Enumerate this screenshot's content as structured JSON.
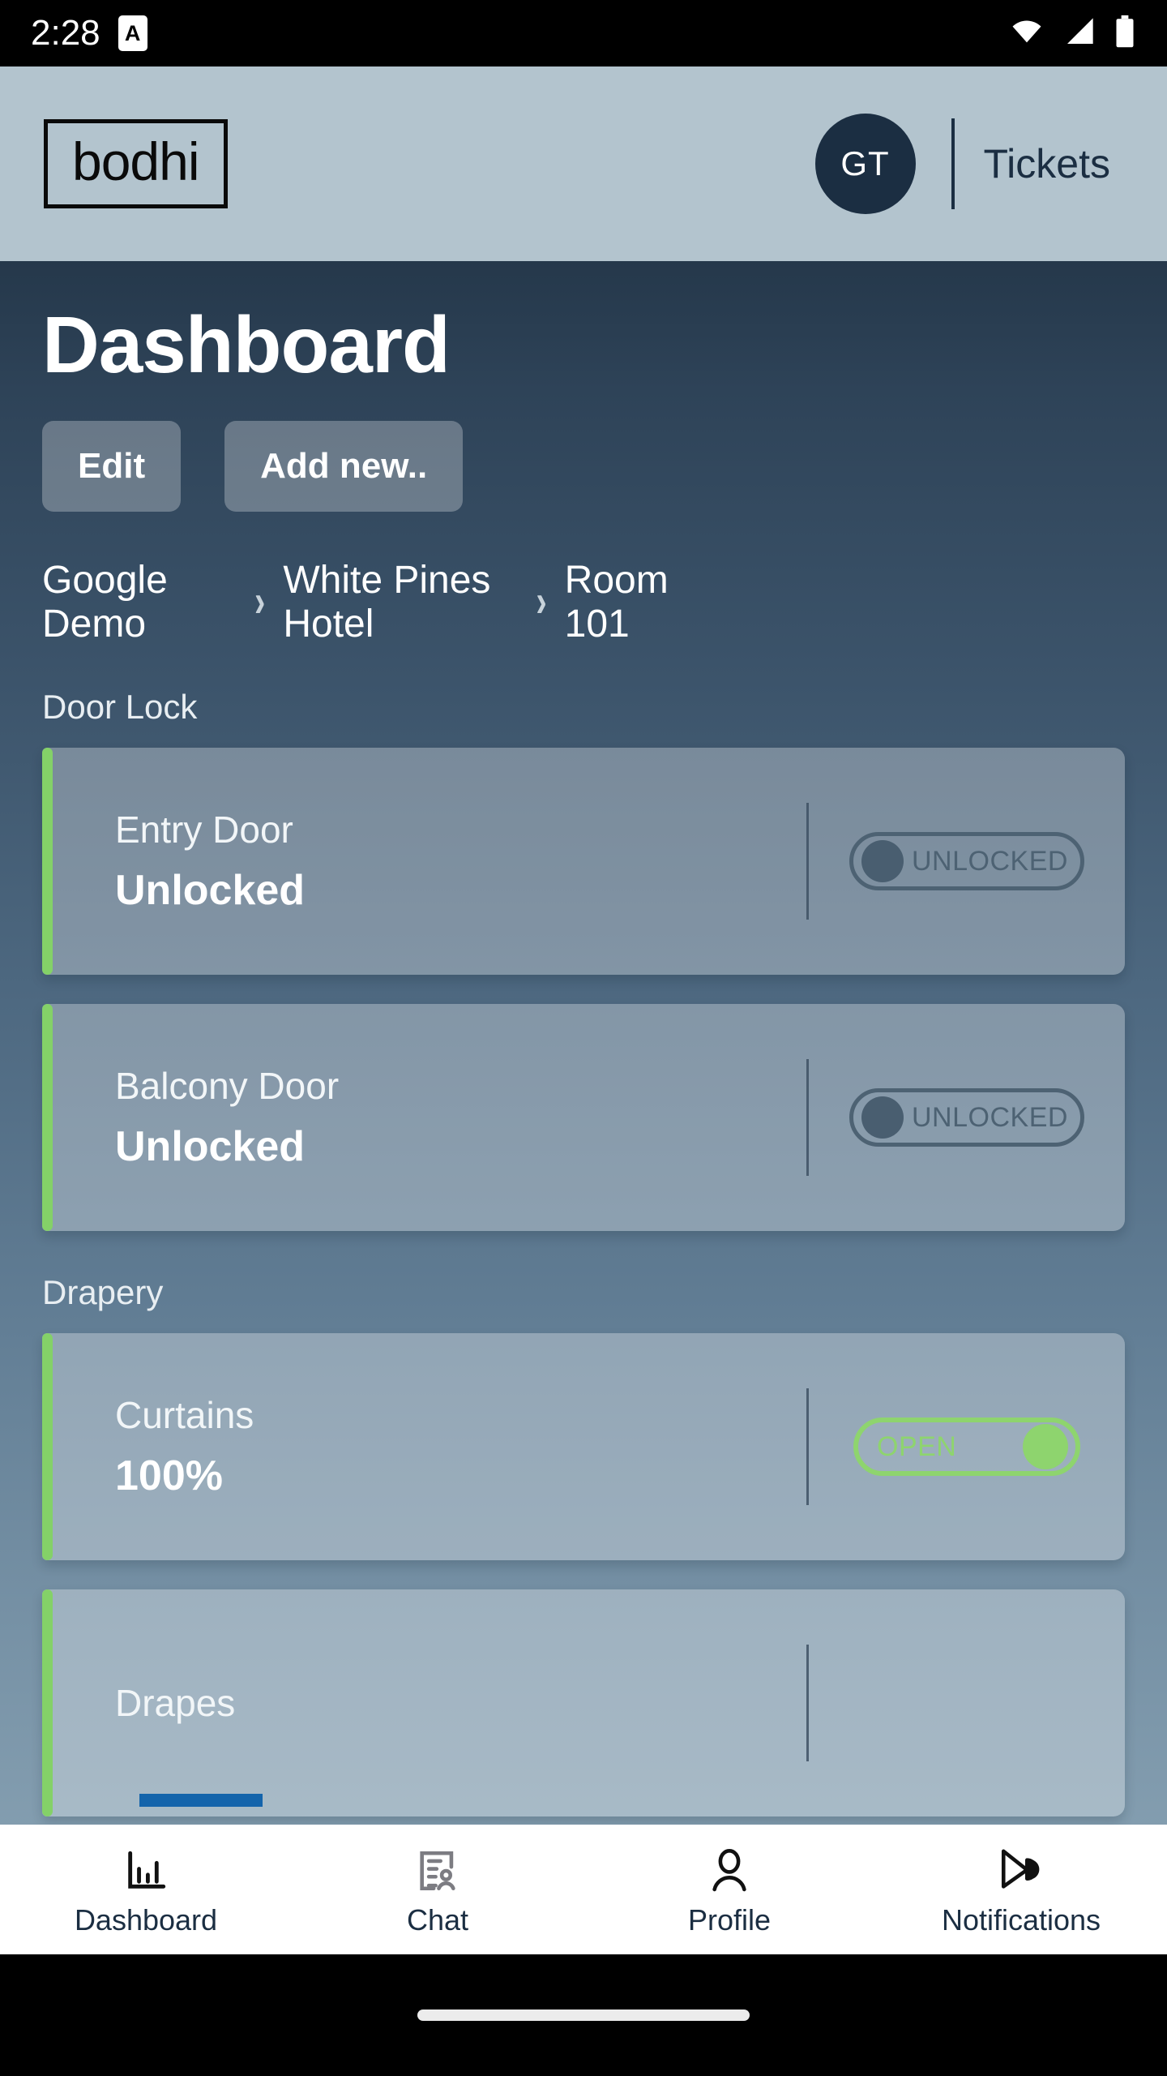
{
  "status_bar": {
    "time": "2:28",
    "app_badge": "A",
    "icons": [
      "wifi-icon",
      "cellular-signal-icon",
      "battery-icon"
    ]
  },
  "header": {
    "logo": "bodhi",
    "avatar_initials": "GT",
    "tickets_label": "Tickets",
    "background_color": "#b3c4ce",
    "accent_color": "#1b2e42"
  },
  "page": {
    "title": "Dashboard",
    "buttons": [
      {
        "label": "Edit",
        "name": "edit-button"
      },
      {
        "label": "Add new..",
        "name": "add-new-button"
      }
    ],
    "breadcrumb": [
      "Google Demo",
      "White Pines Hotel",
      "Room 101"
    ],
    "breadcrumb_separator": "›"
  },
  "sections": [
    {
      "label": "Door Lock",
      "devices": [
        {
          "name": "Entry Door",
          "value": "Unlocked",
          "toggle_label": "UNLOCKED",
          "toggle_state": "off",
          "accent_color": "#84d168"
        },
        {
          "name": "Balcony Door",
          "value": "Unlocked",
          "toggle_label": "UNLOCKED",
          "toggle_state": "off",
          "accent_color": "#84d168"
        }
      ]
    },
    {
      "label": "Drapery",
      "devices": [
        {
          "name": "Curtains",
          "value": "100%",
          "toggle_label": "OPEN",
          "toggle_state": "on",
          "accent_color": "#84d168"
        },
        {
          "name": "Drapes",
          "value": "",
          "toggle_label": "",
          "toggle_state": "partial",
          "accent_color": "#84d168"
        }
      ]
    }
  ],
  "bottom_nav": [
    {
      "label": "Dashboard",
      "icon": "bar-chart-icon",
      "active": true
    },
    {
      "label": "Chat",
      "icon": "chat-document-person-icon",
      "active": false
    },
    {
      "label": "Profile",
      "icon": "person-icon",
      "active": false
    },
    {
      "label": "Notifications",
      "icon": "megaphone-icon",
      "active": false
    }
  ]
}
